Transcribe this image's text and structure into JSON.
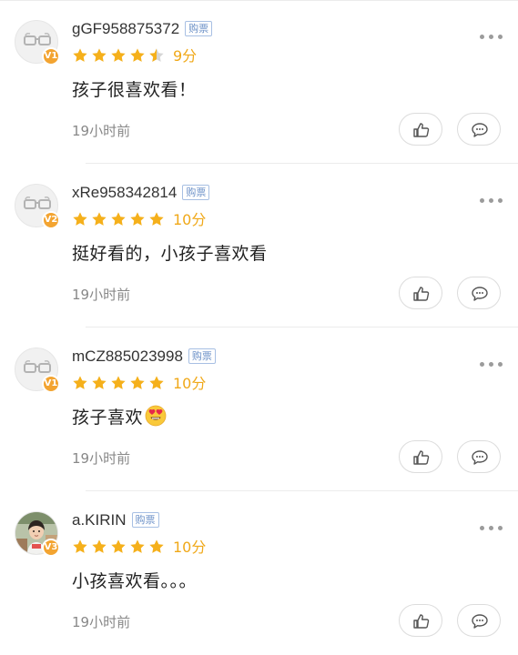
{
  "badge_label": "购票",
  "reviews": [
    {
      "username": "gGF958875372",
      "level": "V1",
      "avatar": "default-glasses-avatar",
      "rating_stars": 4.5,
      "score": "9分",
      "content": "孩子很喜欢看！",
      "emoji": "",
      "time": "19小时前"
    },
    {
      "username": "xRe958342814",
      "level": "V2",
      "avatar": "default-glasses-avatar",
      "rating_stars": 5,
      "score": "10分",
      "content": "挺好看的，小孩子喜欢看",
      "emoji": "",
      "time": "19小时前"
    },
    {
      "username": "mCZ885023998",
      "level": "V1",
      "avatar": "default-glasses-avatar",
      "rating_stars": 5,
      "score": "10分",
      "content": "孩子喜欢",
      "emoji": "heart-eyes-emoji",
      "time": "19小时前"
    },
    {
      "username": "a.KIRIN",
      "level": "V3",
      "avatar": "child-photo-avatar",
      "rating_stars": 5,
      "score": "10分",
      "content": "小孩喜欢看。。。",
      "emoji": "",
      "time": "19小时前"
    }
  ],
  "icons": {
    "like": "thumbs-up-icon",
    "comment": "comment-bubble-icon",
    "more": "more-dots-icon"
  },
  "colors": {
    "star": "#f5b01b",
    "star_empty": "#d6d6d6",
    "level_badge": "#f3a431",
    "purchase_badge": "#6b90c7"
  }
}
